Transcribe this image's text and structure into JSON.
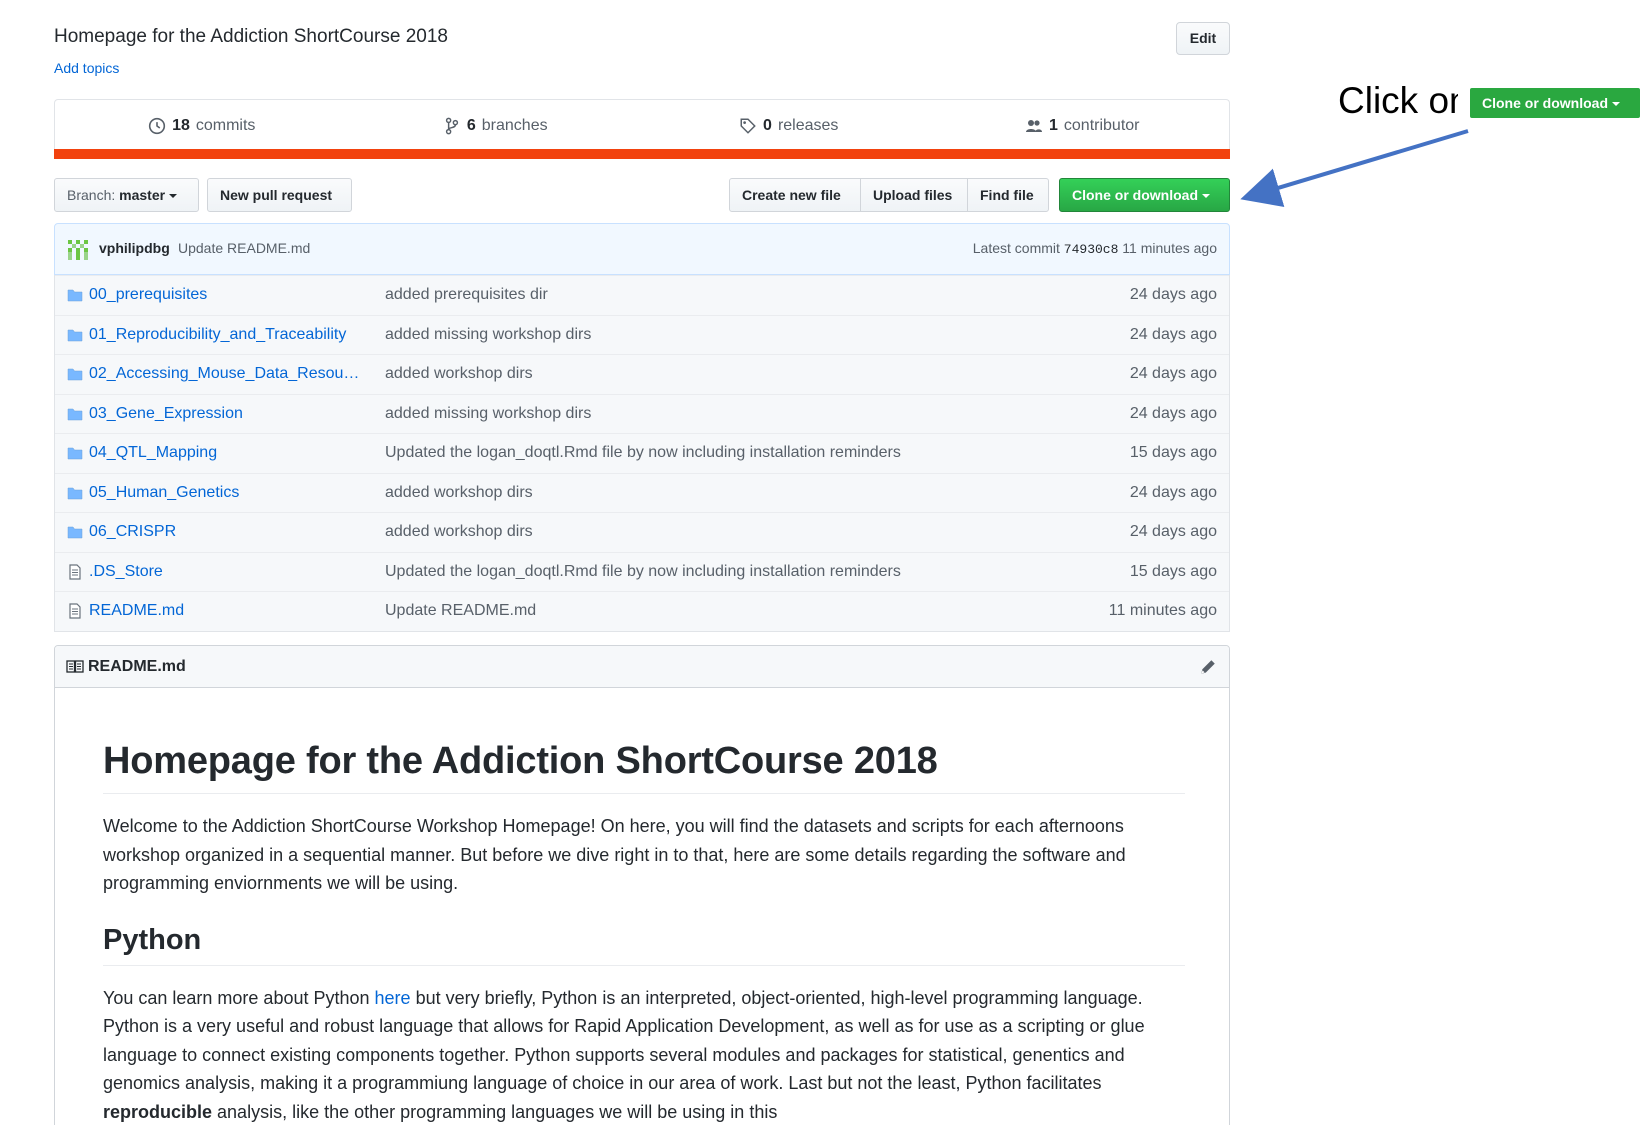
{
  "repo": {
    "description": "Homepage for the Addiction ShortCourse 2018",
    "add_topics": "Add topics",
    "edit_label": "Edit"
  },
  "numbers": [
    {
      "icon": "history-icon",
      "count": "18",
      "label": "commits"
    },
    {
      "icon": "branch-icon",
      "count": "6",
      "label": "branches"
    },
    {
      "icon": "tag-icon",
      "count": "0",
      "label": "releases"
    },
    {
      "icon": "people-icon",
      "count": "1",
      "label": "contributor"
    }
  ],
  "language_bar_color": "#f2420e",
  "file_nav": {
    "branch_prefix": "Branch:",
    "branch_name": "master",
    "new_pull_request": "New pull request",
    "create_new_file": "Create new file",
    "upload_files": "Upload files",
    "find_file": "Find file",
    "clone_or_download": "Clone or download"
  },
  "commit": {
    "author": "vphilipdbg",
    "message": "Update README.md",
    "latest_label": "Latest commit",
    "sha": "74930c8",
    "time": "11 minutes ago"
  },
  "files": [
    {
      "type": "folder",
      "name": "00_prerequisites",
      "message": "added prerequisites dir",
      "age": "24 days ago"
    },
    {
      "type": "folder",
      "name": "01_Reproducibility_and_Traceability",
      "message": "added missing workshop dirs",
      "age": "24 days ago"
    },
    {
      "type": "folder",
      "name": "02_Accessing_Mouse_Data_Resou…",
      "message": "added workshop dirs",
      "age": "24 days ago"
    },
    {
      "type": "folder",
      "name": "03_Gene_Expression",
      "message": "added missing workshop dirs",
      "age": "24 days ago"
    },
    {
      "type": "folder",
      "name": "04_QTL_Mapping",
      "message": "Updated the logan_doqtl.Rmd file by now including installation reminders",
      "age": "15 days ago"
    },
    {
      "type": "folder",
      "name": "05_Human_Genetics",
      "message": "added workshop dirs",
      "age": "24 days ago"
    },
    {
      "type": "folder",
      "name": "06_CRISPR",
      "message": "added workshop dirs",
      "age": "24 days ago"
    },
    {
      "type": "file",
      "name": ".DS_Store",
      "message": "Updated the logan_doqtl.Rmd file by now including installation reminders",
      "age": "15 days ago"
    },
    {
      "type": "file",
      "name": "README.md",
      "message": "Update README.md",
      "age": "11 minutes ago"
    }
  ],
  "readme": {
    "filename": "README.md",
    "heading": "Homepage for the Addiction ShortCourse 2018",
    "intro": "Welcome to the Addiction ShortCourse Workshop Homepage! On here, you will find the datasets and scripts for each afternoons workshop organized in a sequential manner. But before we dive right in to that, here are some details regarding the software and programming enviornments we will be using.",
    "python_heading": "Python",
    "python_p_before": "You can learn more about Python ",
    "python_link": "here",
    "python_p_after": " but very briefly, Python is an interpreted, object-oriented, high-level programming language. Python is a very useful and robust language that allows for Rapid Application Development, as well as for use as a scripting or glue language to connect existing components together. Python supports several modules and packages for statistical, genentics and genomics analysis, making it a programmiung language of choice in our area of work. Last but not the least, Python facilitates ",
    "python_bold": "reproducible",
    "python_p_end": " analysis, like the other programming languages we will be using in this"
  },
  "annotation": {
    "text": "Click on",
    "button_label": "Clone or download",
    "arrow_color": "#4472c4"
  }
}
